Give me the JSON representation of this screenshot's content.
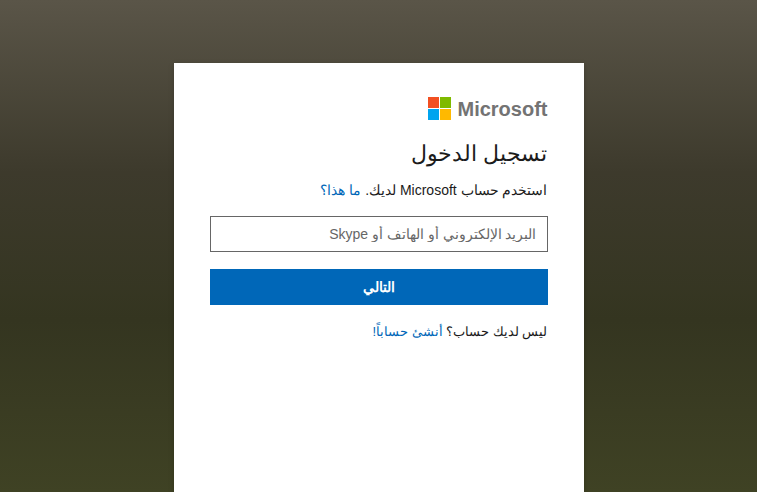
{
  "logo": {
    "text": "Microsoft"
  },
  "heading": "تسجيل الدخول",
  "subtitle": {
    "text": "استخدم حساب Microsoft لديك.",
    "link": "ما هذا؟"
  },
  "input": {
    "placeholder": "البريد الإلكتروني أو الهاتف أو Skype"
  },
  "buttons": [
    {
      "label": "التالي"
    }
  ],
  "footer": {
    "text": "ليس لديك حساب؟",
    "link": "أنشئ حساباً!"
  }
}
